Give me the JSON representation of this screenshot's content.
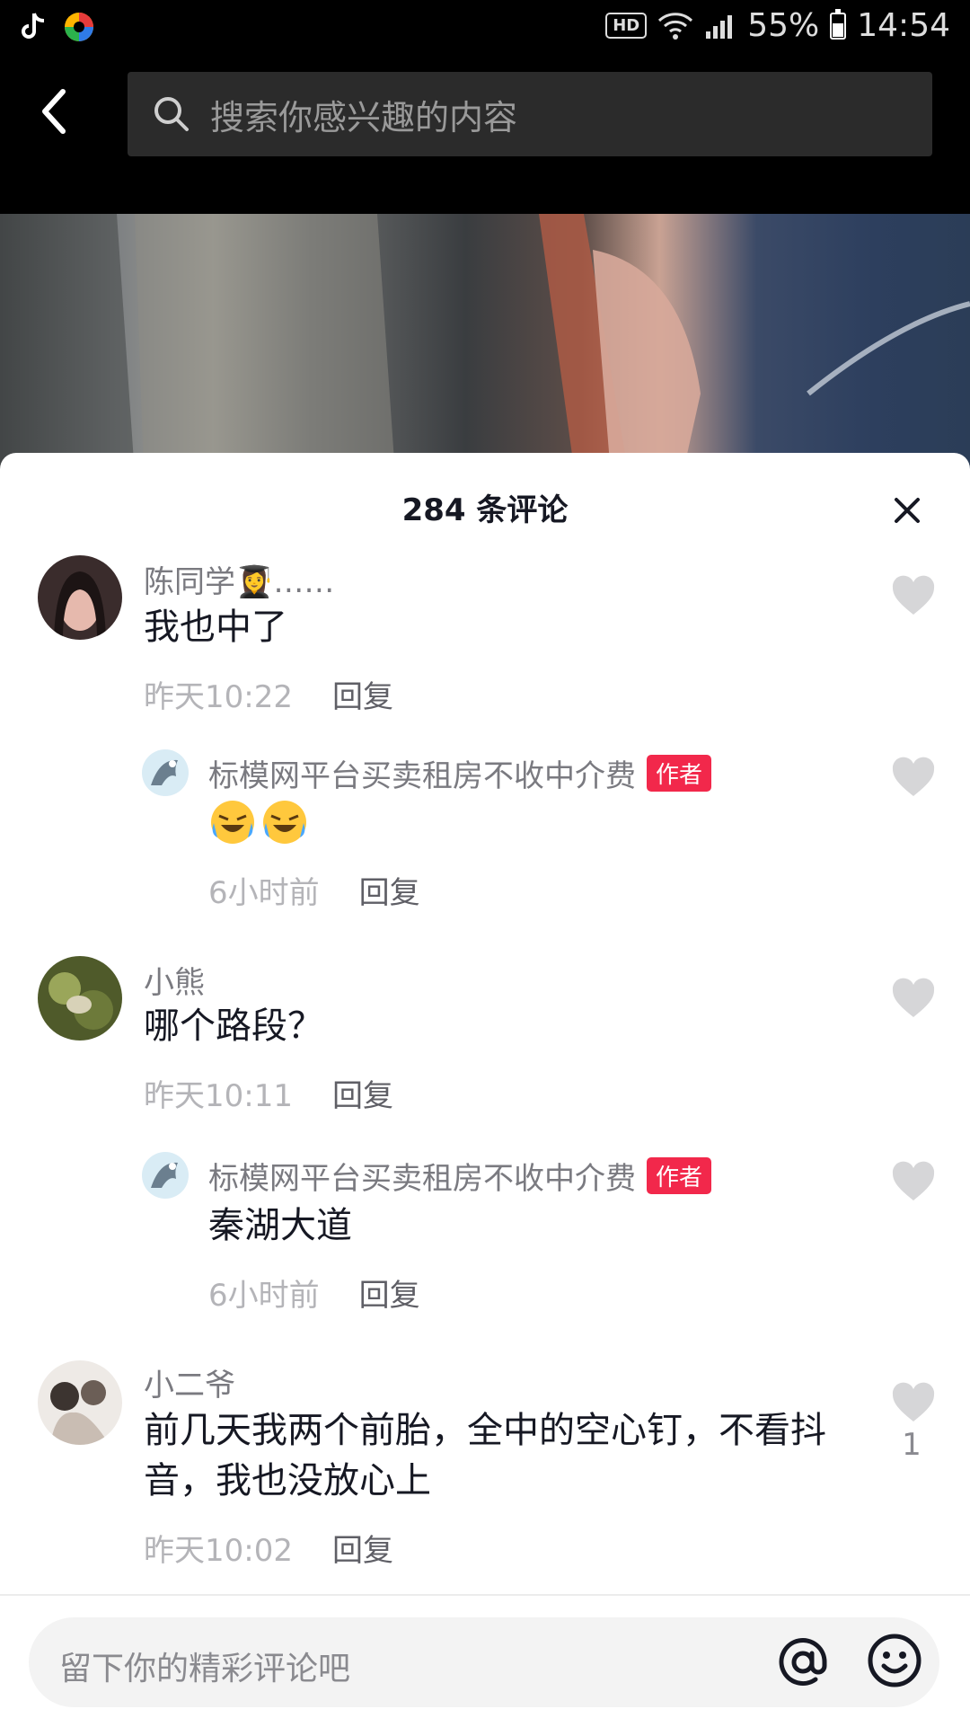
{
  "status_bar": {
    "battery": "55%",
    "time": "14:54",
    "hd_label": "HD",
    "network": "4G"
  },
  "search": {
    "placeholder": "搜索你感兴趣的内容"
  },
  "comments_header": {
    "title": "284 条评论"
  },
  "comments": [
    {
      "username": "陈同学👩‍🎓……",
      "text": "我也中了",
      "time": "昨天10:22",
      "reply_label": "回复",
      "replies": [
        {
          "username": "标模网平台买卖租房不收中介费",
          "badge": "作者",
          "emoji": [
            "🤣",
            "🤣"
          ],
          "time": "6小时前",
          "reply_label": "回复"
        }
      ]
    },
    {
      "username": "小熊",
      "text": "哪个路段？",
      "time": "昨天10:11",
      "reply_label": "回复",
      "replies": [
        {
          "username": "标模网平台买卖租房不收中介费",
          "badge": "作者",
          "text": "秦湖大道",
          "time": "6小时前",
          "reply_label": "回复"
        }
      ]
    },
    {
      "username": "小二爷",
      "text_line1": "前几天我两个前胎，全中的空心钉，不看抖",
      "text_line2": "音，我也没放心上",
      "time": "昨天10:02",
      "reply_label": "回复",
      "like_count": "1"
    }
  ],
  "input": {
    "placeholder": "留下你的精彩评论吧"
  },
  "colors": {
    "author_badge": "#f2284b",
    "like_icon": "#d6d6d8",
    "text_primary": "#161823",
    "text_secondary": "#7a7a80"
  }
}
